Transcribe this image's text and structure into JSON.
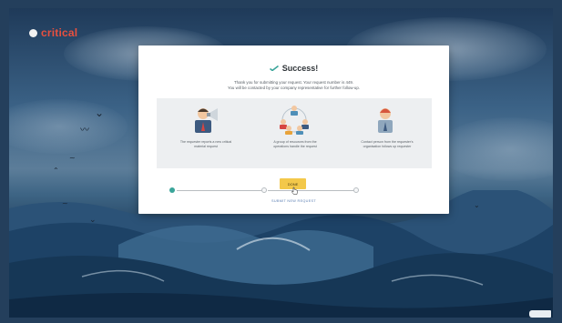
{
  "brand": {
    "logo_text": "critical",
    "accent": "#e8503f"
  },
  "modal": {
    "title": "Success!",
    "message_line1": "Thank you for submitting your request. Your request number is 449.",
    "message_line2": "You will be contacted by your company representative for further follow-up.",
    "steps": [
      {
        "label": "The requester reports a new critical material request",
        "status": "done"
      },
      {
        "label": "A group of resources from the operations handle the request",
        "status": "pending"
      },
      {
        "label": "Contact person from the requester's organisation follows up requester",
        "status": "pending"
      }
    ],
    "done_button": "Done",
    "submit_new_link": "SUBMIT NEW REQUEST"
  },
  "colors": {
    "success_check": "#3aa59a",
    "done_button": "#f3c84a",
    "link": "#5b7fb3"
  },
  "icons": [
    "logo-dot-icon",
    "checkmark-icon",
    "megaphone-person-icon",
    "team-group-icon",
    "support-person-icon",
    "hand-cursor-icon",
    "hand-pointer-icon"
  ]
}
